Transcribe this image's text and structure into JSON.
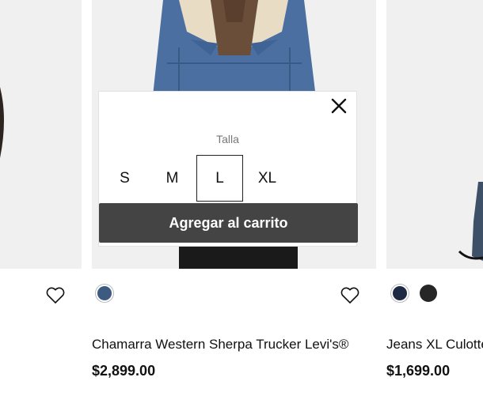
{
  "popup": {
    "size_title": "Talla",
    "sizes": [
      "S",
      "M",
      "L",
      "XL"
    ],
    "selected_size": "L",
    "add_to_cart": "Agregar al carrito",
    "close_icon": "close-icon"
  },
  "products": [
    {
      "name": "Chamarra Western Sherpa Trucker Levi's®",
      "price": "$2,899.00",
      "colors": [
        "#3d5a80"
      ]
    },
    {
      "name": "Jeans XL Culotte",
      "price": "$1,699.00",
      "colors": [
        "#1e2a44",
        "#262626"
      ]
    }
  ],
  "icons": {
    "wishlist": "heart-icon"
  },
  "colors": {
    "tile_bg": "#f0f0f0",
    "cart_button": "#454444",
    "denim": "#4a6fa0",
    "hoodie": "#6b4e3a",
    "sherpa": "#e9dcc5",
    "pants": "#1a1a1a"
  }
}
